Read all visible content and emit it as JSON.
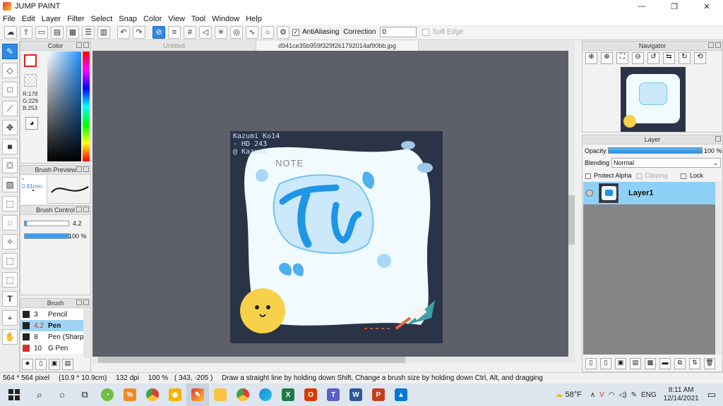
{
  "window": {
    "title": "JUMP PAINT",
    "controls": [
      "—",
      "❐",
      "✕"
    ]
  },
  "menu": [
    "File",
    "Edit",
    "Layer",
    "Filter",
    "Select",
    "Snap",
    "Color",
    "View",
    "Tool",
    "Window",
    "Help"
  ],
  "toolbar": {
    "antialias_label": "AntiAliasing",
    "correction_label": "Correction",
    "correction_value": "0",
    "soft_edge_label": "Soft Edge"
  },
  "tabs": [
    "Untitled",
    "d941ce35b959f329f261792014af90bb.jpg"
  ],
  "color_panel": {
    "title": "Color",
    "r": "R:178",
    "g": "G:229",
    "b": "B:253"
  },
  "brush_preview": {
    "title": "Brush Preview",
    "size": "* 0.81mm"
  },
  "brush_control": {
    "title": "Brush Control",
    "size_value": "4.2",
    "opacity_value": "100 %"
  },
  "brush_list": {
    "title": "Brush",
    "items": [
      {
        "size": "3",
        "name": "Pencil"
      },
      {
        "size": "4.2",
        "name": "Pen"
      },
      {
        "size": "8",
        "name": "Pen (Sharp"
      },
      {
        "size": "10",
        "name": "G Pen"
      }
    ]
  },
  "navigator": {
    "title": "Navigator"
  },
  "layer_panel": {
    "title": "Layer",
    "opacity_label": "Opacity",
    "opacity_value": "100 %",
    "blending_label": "Blending",
    "blending_value": "Normal",
    "protect_alpha": "Protect Alpha",
    "clipping": "Clipping",
    "lock": "Lock",
    "layer_name": "Layer1"
  },
  "artwork": {
    "signature": [
      "Kazumi Ko14",
      "- HD 243",
      "@ Kazumi"
    ],
    "note": "NOTE",
    "logo": "Tr"
  },
  "status": {
    "size": "564 * 564 pixel",
    "physical": "(10.9 * 10.9cm)",
    "dpi": "132 dpi",
    "zoom": "100 %",
    "coords": "( 343, -205 )",
    "hint": "Draw a straight line by holding down Shift, Change a brush size by holding down Ctrl, Alt, and dragging"
  },
  "tray": {
    "weather": "58°F",
    "lang": "ENG",
    "time": "8:11 AM",
    "date": "12/14/2021"
  }
}
